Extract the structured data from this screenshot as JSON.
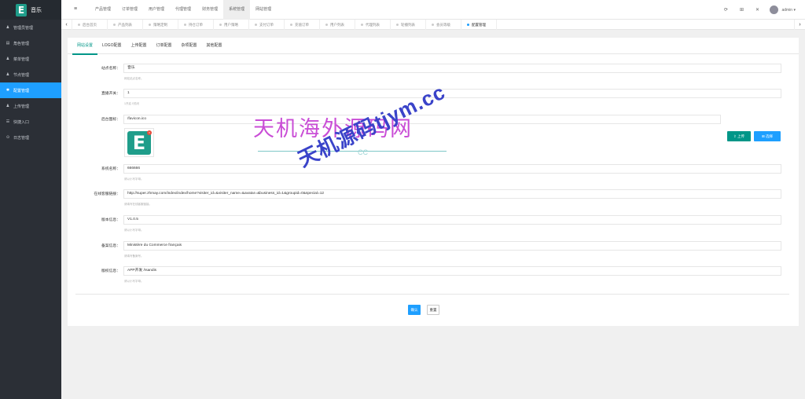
{
  "app": {
    "logo_letter": "E",
    "title": "音乐"
  },
  "sidebar": {
    "items": [
      {
        "icon": "user-icon",
        "glyph": "♟",
        "label": "管理员管理",
        "active": false
      },
      {
        "icon": "doc-icon",
        "glyph": "▤",
        "label": "角色管理",
        "active": false
      },
      {
        "icon": "user-icon",
        "glyph": "♟",
        "label": "菜单管理",
        "active": false
      },
      {
        "icon": "user-icon",
        "glyph": "♟",
        "label": "节点管理",
        "active": false
      },
      {
        "icon": "gear-icon",
        "glyph": "✱",
        "label": "配置管理",
        "active": true
      },
      {
        "icon": "user-icon",
        "glyph": "♟",
        "label": "上传管理",
        "active": false
      },
      {
        "icon": "list-icon",
        "glyph": "☰",
        "label": "快捷入口",
        "active": false
      },
      {
        "icon": "globe-icon",
        "glyph": "⊙",
        "label": "日志管理",
        "active": false
      }
    ]
  },
  "topnav": {
    "menu_icon": "≡",
    "items": [
      "产品管理",
      "订单管理",
      "用户管理",
      "代理管理",
      "财务管理",
      "系统管理",
      "网站管理"
    ],
    "active_index": 5,
    "right_icons": [
      "⟳",
      "⊞",
      "✕"
    ],
    "user": "admin ▾"
  },
  "tabs": {
    "left_arrow": "‹",
    "right_arrow": "›",
    "items": [
      "后台首页",
      "产品列表",
      "策略定制",
      "持仓订单",
      "用户策略",
      "支付订单",
      "充值订单",
      "用户列表",
      "代理列表",
      "轮播列表",
      "会员等级",
      "配置管理"
    ],
    "active_index": 11
  },
  "config": {
    "tabs": [
      "网站设置",
      "LOGO配置",
      "上传配置",
      "订单配置",
      "杂项配置",
      "其他配置"
    ],
    "active_tab": 0,
    "fields": [
      {
        "label": "站点名称：",
        "value": "音乐",
        "hint": "网站站点名称。"
      },
      {
        "label": "直播开关：",
        "value": "1",
        "hint": "1开启 0关闭"
      },
      {
        "label": "后台图标：",
        "value": "/favicon.ico",
        "hint": ""
      },
      {
        "label": "系统名称：",
        "value": "666666",
        "hint": "请以小写字母。"
      },
      {
        "label": "在线客服链接：",
        "value": "http://super.zhmay.com/index/index/home?visiter_id=&visiter_name=&avatar=&business_id=1&groupid=0&special=12",
        "hint": "请填写在线客服链接。"
      },
      {
        "label": "版本信息：",
        "value": "V1.0.5",
        "hint": "请以小写字母。"
      },
      {
        "label": "备案信息：",
        "value": "Ministère du Commerce français",
        "hint": "请填写备案号。"
      },
      {
        "label": "版权信息：",
        "value": "APP开发 /Isandis",
        "hint": "请以小写字母。"
      }
    ],
    "upload_label": "⇪ 上传",
    "select_label": "⊞ 选择",
    "logo_letter": "E",
    "logo_close": "×",
    "submit_label": "确认",
    "reset_label": "重置"
  },
  "watermark": {
    "line1": "天机海外源码网",
    "line2": "天机源码tjym.cc",
    "cc": "CC"
  }
}
